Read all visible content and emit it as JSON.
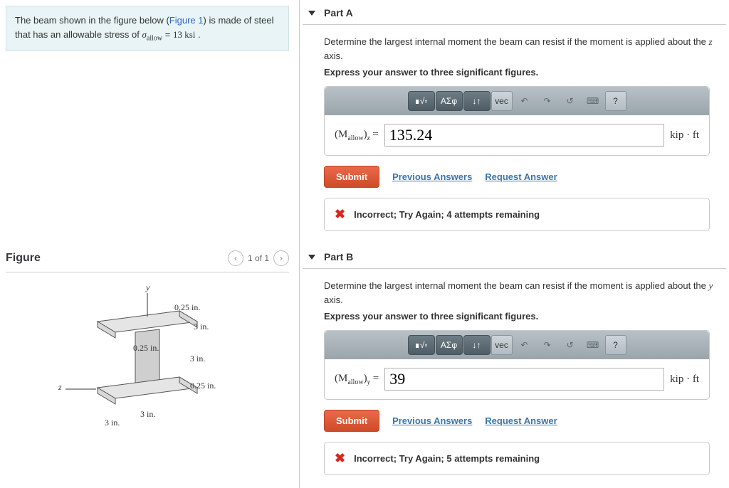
{
  "problem": {
    "text_prefix": "The beam shown in the figure below (",
    "figure_link": "Figure 1",
    "text_mid1": ") is made of steel that has an allowable stress of ",
    "sigma_html": "σ",
    "sigma_sub": "allow",
    "equals": " = ",
    "stress_value": "13",
    "stress_unit": "ksi",
    "period": " ."
  },
  "figure": {
    "title": "Figure",
    "pager_text": "1 of 1",
    "labels": {
      "y": "y",
      "z": "z",
      "t1": "0.25 in.",
      "t2": "3 in.",
      "t3": "0.25 in.",
      "t4": "3 in.",
      "t5": "0.25 in.",
      "t6": "3 in.",
      "t7": "3 in."
    }
  },
  "toolbar": {
    "templates": "∎√▫",
    "greek": "ΑΣφ",
    "subscript": "↓↑",
    "vec": "vec",
    "undo": "↶",
    "redo": "↷",
    "reset": "↺",
    "keyboard": "⌨",
    "help": "?"
  },
  "partA": {
    "title": "Part A",
    "instruction_prefix": "Determine the largest internal moment the beam can resist if the moment is applied about the ",
    "axis": "z",
    "instruction_suffix": " axis.",
    "express": "Express your answer to three significant figures.",
    "var_prefix": "(M",
    "var_sub": "allow",
    "var_close": ")",
    "var_axis": "z",
    "var_equals": " = ",
    "value": "135.24",
    "unit": "kip · ft",
    "submit": "Submit",
    "prev_answers": "Previous Answers",
    "request_answer": "Request Answer",
    "feedback": "Incorrect; Try Again; 4 attempts remaining"
  },
  "partB": {
    "title": "Part B",
    "instruction_prefix": "Determine the largest internal moment the beam can resist if the moment is applied about the ",
    "axis": "y",
    "instruction_suffix": " axis.",
    "express": "Express your answer to three significant figures.",
    "var_prefix": "(M",
    "var_sub": "allow",
    "var_close": ")",
    "var_axis": "y",
    "var_equals": " = ",
    "value": "39",
    "unit": "kip · ft",
    "submit": "Submit",
    "prev_answers": "Previous Answers",
    "request_answer": "Request Answer",
    "feedback": "Incorrect; Try Again; 5 attempts remaining"
  }
}
